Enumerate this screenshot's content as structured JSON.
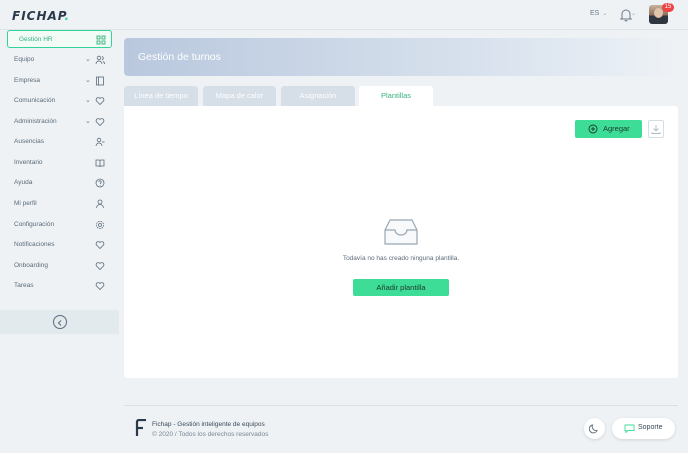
{
  "app": {
    "logo": "FICHAP",
    "logo_dot": "."
  },
  "topbar": {
    "language": "ES",
    "notifications_count": "15"
  },
  "sidebar": {
    "active": {
      "label": "Gestión HR",
      "icon": "grid-icon"
    },
    "items": [
      {
        "label": "Equipo",
        "has_chevron": true,
        "icon": "users-icon"
      },
      {
        "label": "Empresa",
        "has_chevron": true,
        "icon": "book-icon"
      },
      {
        "label": "Comunicación",
        "has_chevron": true,
        "icon": "heart-icon"
      },
      {
        "label": "Administración",
        "has_chevron": true,
        "icon": "heart-icon"
      },
      {
        "label": "Ausencias",
        "has_chevron": false,
        "icon": "user-minus-icon"
      },
      {
        "label": "Inventario",
        "has_chevron": false,
        "icon": "book-open-icon"
      },
      {
        "label": "Ayuda",
        "has_chevron": false,
        "icon": "help-circle-icon"
      },
      {
        "label": "Mi perfil",
        "has_chevron": false,
        "icon": "user-icon"
      },
      {
        "label": "Configuración",
        "has_chevron": false,
        "icon": "gear-icon"
      },
      {
        "label": "Notificaciones",
        "has_chevron": false,
        "icon": "heart-icon"
      },
      {
        "label": "Onboarding",
        "has_chevron": false,
        "icon": "heart-icon"
      },
      {
        "label": "Tareas",
        "has_chevron": false,
        "icon": "heart-icon"
      }
    ],
    "collapse_icon": "chevron-left-circle-icon"
  },
  "header": {
    "title": "Gestión de turnos"
  },
  "tabs": [
    {
      "label": "Línea de tiempo",
      "active": false
    },
    {
      "label": "Mapa de calor",
      "active": false
    },
    {
      "label": "Asignación",
      "active": false
    },
    {
      "label": "Plantillas",
      "active": true
    }
  ],
  "panel": {
    "add_label": "Agregar",
    "empty_message": "Todavía no has creado ninguna plantilla.",
    "add_template_label": "Añadir plantilla"
  },
  "footer": {
    "name": "Fichap - Gestión inteligente de equipos",
    "copyright": "© 2020 / Todos los derechos reservados",
    "support_label": "Soporte"
  },
  "colors": {
    "accent": "#3ddc97",
    "accent_text": "#34b27d",
    "banner_start": "#b9c8de",
    "badge": "#ef4444"
  }
}
